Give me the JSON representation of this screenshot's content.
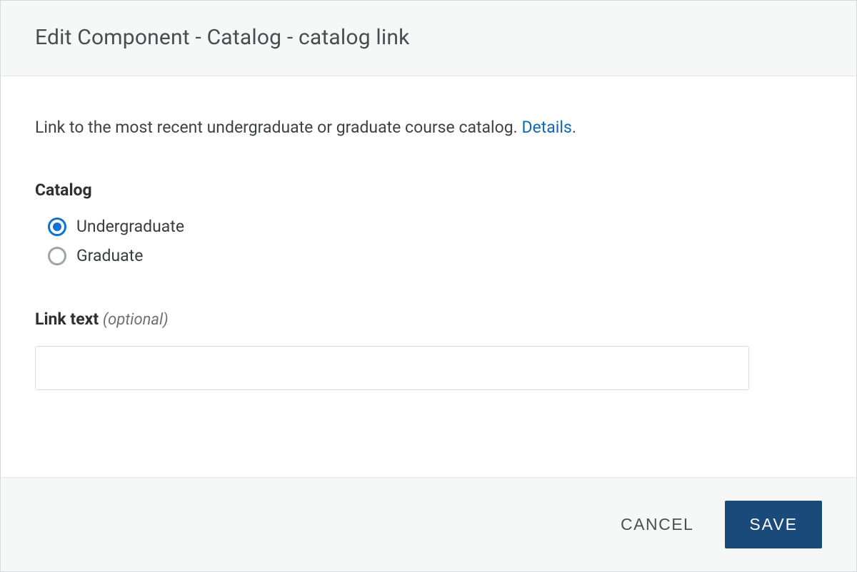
{
  "header": {
    "title": "Edit Component - Catalog - catalog link"
  },
  "body": {
    "description_pre": "Link to the most recent undergraduate or graduate course catalog.  ",
    "details_label": "Details",
    "description_post": ".",
    "catalog": {
      "label": "Catalog",
      "options": [
        {
          "label": "Undergraduate",
          "selected": true
        },
        {
          "label": "Graduate",
          "selected": false
        }
      ]
    },
    "link_text": {
      "label": "Link text ",
      "optional": "(optional)",
      "value": ""
    }
  },
  "footer": {
    "cancel": "CANCEL",
    "save": "SAVE"
  }
}
